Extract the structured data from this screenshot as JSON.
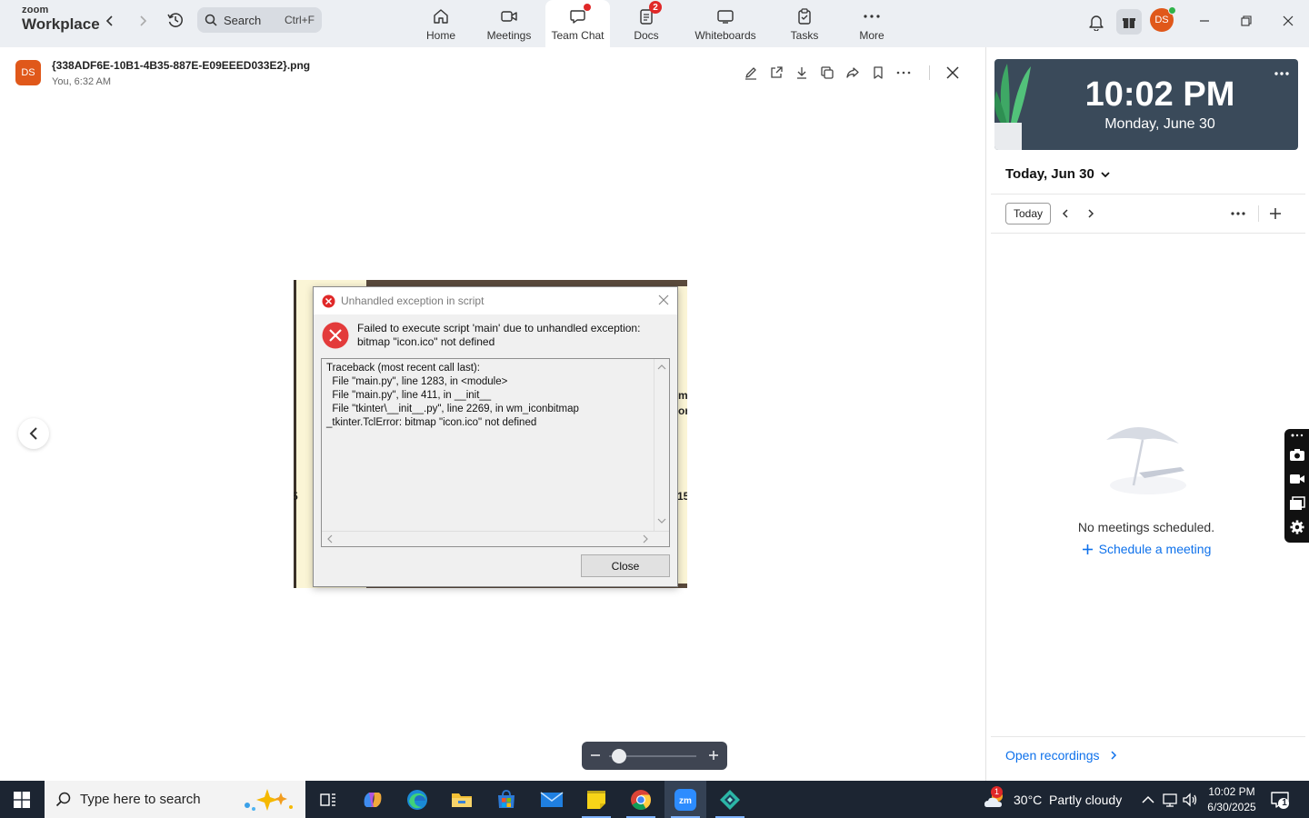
{
  "app": {
    "brand_small": "zoom",
    "brand_large": "Workplace"
  },
  "search": {
    "label": "Search",
    "shortcut": "Ctrl+F"
  },
  "tabs": [
    {
      "label": "Home",
      "active": false
    },
    {
      "label": "Meetings",
      "active": false
    },
    {
      "label": "Team Chat",
      "active": true
    },
    {
      "label": "Docs",
      "active": false,
      "badge": "2"
    },
    {
      "label": "Whiteboards",
      "active": false
    },
    {
      "label": "Tasks",
      "active": false
    },
    {
      "label": "More",
      "active": false
    }
  ],
  "user": {
    "initials": "DS",
    "color": "#e0581a"
  },
  "file": {
    "name": "{338ADF6E-10B1-4B35-887E-E09EEED033E2}.png",
    "meta": "You, 6:32 AM"
  },
  "photo_fragments": {
    "f1": "m",
    "f2": "or",
    "f3": "15",
    "f4": "5"
  },
  "dialog": {
    "title": "Unhandled exception in script",
    "message_line1": "Failed to execute script 'main' due to unhandled exception:",
    "message_line2": "bitmap \"icon.ico\" not defined",
    "traceback": "Traceback (most recent call last):\n  File \"main.py\", line 1283, in <module>\n  File \"main.py\", line 411, in __init__\n  File \"tkinter\\__init__.py\", line 2269, in wm_iconbitmap\n_tkinter.TclError: bitmap \"icon.ico\" not defined",
    "close_label": "Close"
  },
  "zoom_control": {
    "level_fraction": 0.05
  },
  "calendar": {
    "time": "10:02 PM",
    "date": "Monday, June 30",
    "header_date": "Today, Jun 30",
    "today_label": "Today",
    "empty_text": "No meetings scheduled.",
    "schedule_label": "Schedule a meeting",
    "recordings_label": "Open recordings"
  },
  "taskbar": {
    "search_placeholder": "Type here to search",
    "weather": "30°C  Partly cloudy",
    "weather_badge": "1",
    "clock_time": "10:02 PM",
    "clock_date": "6/30/2025",
    "notifications": "1"
  },
  "colors": {
    "accent": "#0e71eb",
    "error": "#e02828",
    "topbar": "#eceff3"
  }
}
